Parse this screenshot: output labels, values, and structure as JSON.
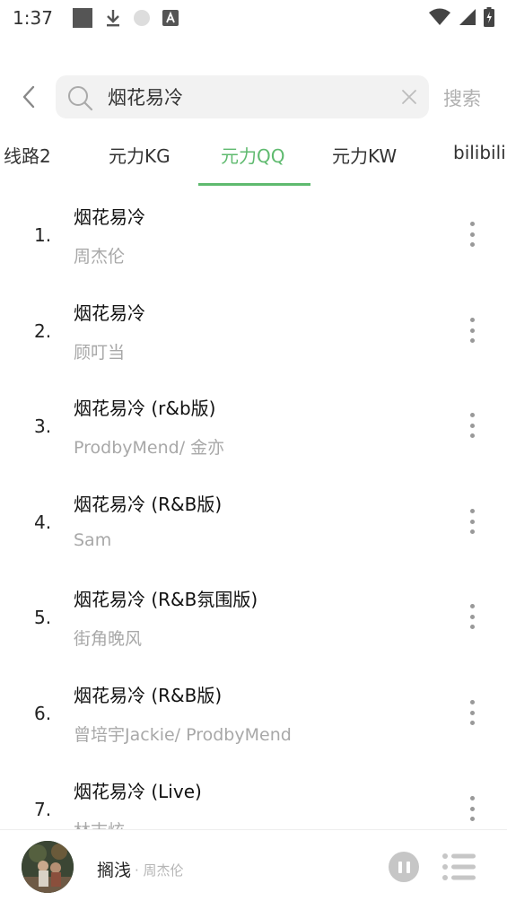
{
  "status_bar": {
    "time": "1:37",
    "icons": [
      "app-square-icon",
      "download-icon",
      "circle-icon",
      "font-icon",
      "wifi-icon",
      "signal-icon",
      "battery-icon"
    ]
  },
  "search": {
    "query": "烟花易冷",
    "button_label": "搜索"
  },
  "tabs": [
    {
      "label": "线路2",
      "active": false
    },
    {
      "label": "元力KG",
      "active": false
    },
    {
      "label": "元力QQ",
      "active": true
    },
    {
      "label": "元力KW",
      "active": false
    },
    {
      "label": "bilibili",
      "active": false
    }
  ],
  "results": [
    {
      "index": "1.",
      "title": "烟花易冷",
      "artist": "周杰伦"
    },
    {
      "index": "2.",
      "title": "烟花易冷",
      "artist": "顾叮当"
    },
    {
      "index": "3.",
      "title": "烟花易冷 (r&b版)",
      "artist": "ProdbyMend/ 金亦"
    },
    {
      "index": "4.",
      "title": "烟花易冷 (R&B版)",
      "artist": "Sam"
    },
    {
      "index": "5.",
      "title": "烟花易冷 (R&B氛围版)",
      "artist": "街角晚风"
    },
    {
      "index": "6.",
      "title": "烟花易冷 (R&B版)",
      "artist": "曾培宇Jackie/ ProdbyMend"
    },
    {
      "index": "7.",
      "title": "烟花易冷 (Live)",
      "artist": "林志炫"
    }
  ],
  "player": {
    "title": "搁浅",
    "artist": "· 周杰伦"
  },
  "colors": {
    "accent": "#5fba6f",
    "secondary_text": "#a8a8a8"
  }
}
